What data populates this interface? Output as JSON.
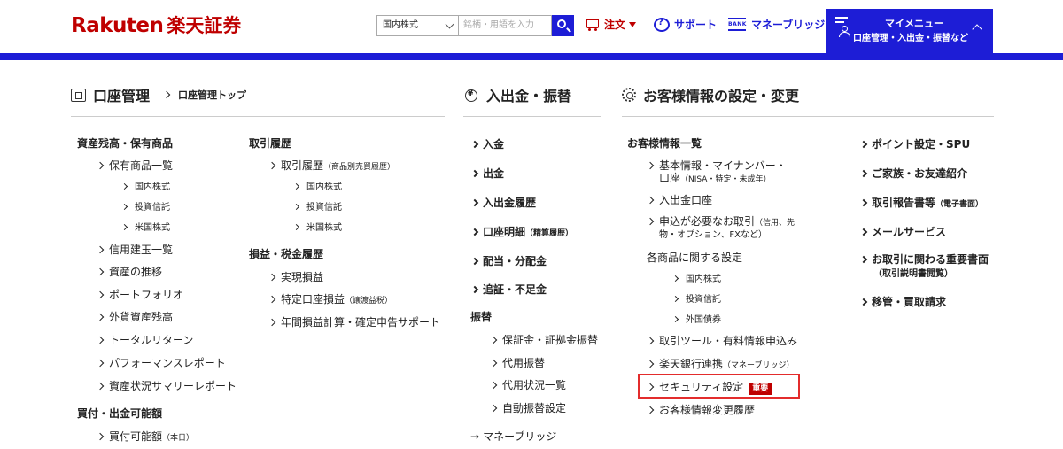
{
  "header": {
    "logo_text": "Rakuten",
    "logo_sec": "楽天証券",
    "search_select": "国内株式",
    "search_placeholder": "銘柄・用語を入力",
    "nav_order": "注文",
    "nav_support": "サポート",
    "nav_bank_icon_text": "BANK",
    "nav_bank": "マネーブリッジ",
    "mymenu_title": "マイメニュー",
    "mymenu_sub": "口座管理・入出金・振替など"
  },
  "sections": {
    "account": {
      "title": "口座管理",
      "sub": "口座管理トップ"
    },
    "deposit": {
      "title": "入出金・振替"
    },
    "customer": {
      "title": "お客様情報の設定・変更"
    }
  },
  "col1": {
    "h1": "資産残高・保有商品",
    "i1": "保有商品一覧",
    "i1a": "国内株式",
    "i1b": "投資信託",
    "i1c": "米国株式",
    "i2": "信用建玉一覧",
    "i3": "資産の推移",
    "i4": "ポートフォリオ",
    "i5": "外貨資産残高",
    "i6": "トータルリターン",
    "i7": "パフォーマンスレポート",
    "i8": "資産状況サマリーレポート",
    "h2": "買付・出金可能額",
    "i9": "買付可能額",
    "i9_note": "（本日）"
  },
  "col2": {
    "h1": "取引履歴",
    "i1": "取引履歴",
    "i1_note": "（商品別売買履歴）",
    "i1a": "国内株式",
    "i1b": "投資信託",
    "i1c": "米国株式",
    "h2": "損益・税金履歴",
    "i2": "実現損益",
    "i3": "特定口座損益",
    "i3_note": "（譲渡益税）",
    "i4": "年間損益計算・確定申告サポート"
  },
  "col3": {
    "i1": "入金",
    "i2": "出金",
    "i3": "入出金履歴",
    "i4": "口座明細",
    "i4_note": "（精算履歴）",
    "i5": "配当・分配金",
    "i6": "追証・不足金",
    "h1": "振替",
    "i7": "保証金・証拠金振替",
    "i8": "代用振替",
    "i9": "代用状況一覧",
    "i10": "自動振替設定",
    "i11": "マネーブリッジ"
  },
  "col4": {
    "h1": "お客様情報一覧",
    "i1_l1": "基本情報・マイナンバー・",
    "i1_l2": "口座",
    "i1_note": "（NISA・特定・未成年）",
    "i2": "入出金口座",
    "i3_l1": "申込が必要なお取引",
    "i3_note1": "（信用、先",
    "i3_l2": "物・オプション、FXなど）",
    "h2": "各商品に関する設定",
    "i4a": "国内株式",
    "i4b": "投資信託",
    "i4c": "外国債券",
    "i5": "取引ツール・有料情報申込み",
    "i6": "楽天銀行連携",
    "i6_note": "（マネーブリッジ）",
    "i7": "セキュリティ設定",
    "i7_badge": "重要",
    "i8": "お客様情報変更履歴"
  },
  "col5": {
    "i1": "ポイント設定・SPU",
    "i2": "ご家族・お友達紹介",
    "i3": "取引報告書等",
    "i3_note": "（電子書面）",
    "i4": "メールサービス",
    "i5_l1": "お取引に関わる重要書面",
    "i5_l2": "（取引説明書閲覧）",
    "i6": "移管・買取請求"
  }
}
